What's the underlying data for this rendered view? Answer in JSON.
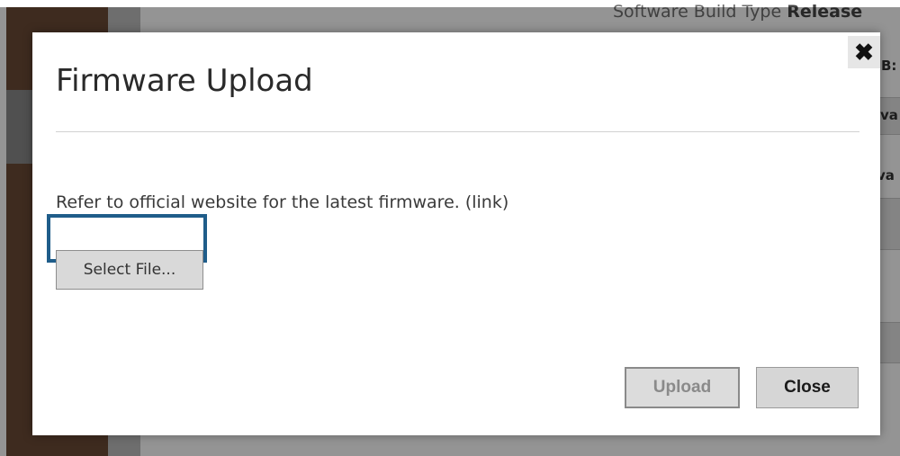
{
  "background": {
    "build_label": "Software Build Type",
    "build_value": "Release",
    "fragments": [
      "B:",
      "va",
      "va"
    ]
  },
  "dialog": {
    "title": "Firmware Upload",
    "close_icon": "close-icon",
    "close_glyph": "✖",
    "info_text": "Refer to official website for the latest firmware. (link)",
    "select_file_label": "Select File...",
    "upload_label": "Upload",
    "close_label": "Close"
  },
  "colors": {
    "focus_border": "#1f5d8a",
    "sidebar": "#6b4a36",
    "overlay": "rgba(0,0,0,0.42)"
  }
}
